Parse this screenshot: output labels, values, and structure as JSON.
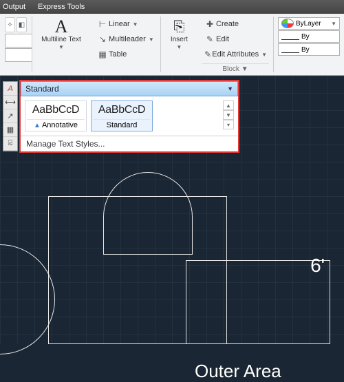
{
  "menu": {
    "output": "Output",
    "express": "Express Tools"
  },
  "ribbon": {
    "multiline_text": "Multiline Text",
    "linear": "Linear",
    "multileader": "Multileader",
    "table": "Table",
    "insert": "Insert",
    "create": "Create",
    "edit": "Edit",
    "edit_attributes": "Edit Attributes",
    "block_panel": "Block",
    "bylayer": "ByLayer",
    "lineweight1": "By",
    "lineweight2": "By"
  },
  "text_style": {
    "selected": "Standard",
    "items": [
      {
        "sample": "AaBbCcD",
        "name": "Annotative",
        "annotative": true
      },
      {
        "sample": "AaBbCcD",
        "name": "Standard",
        "annotative": false
      }
    ],
    "manage": "Manage Text Styles..."
  },
  "drawing": {
    "dim6": "6'",
    "outer": "Outer Area"
  }
}
